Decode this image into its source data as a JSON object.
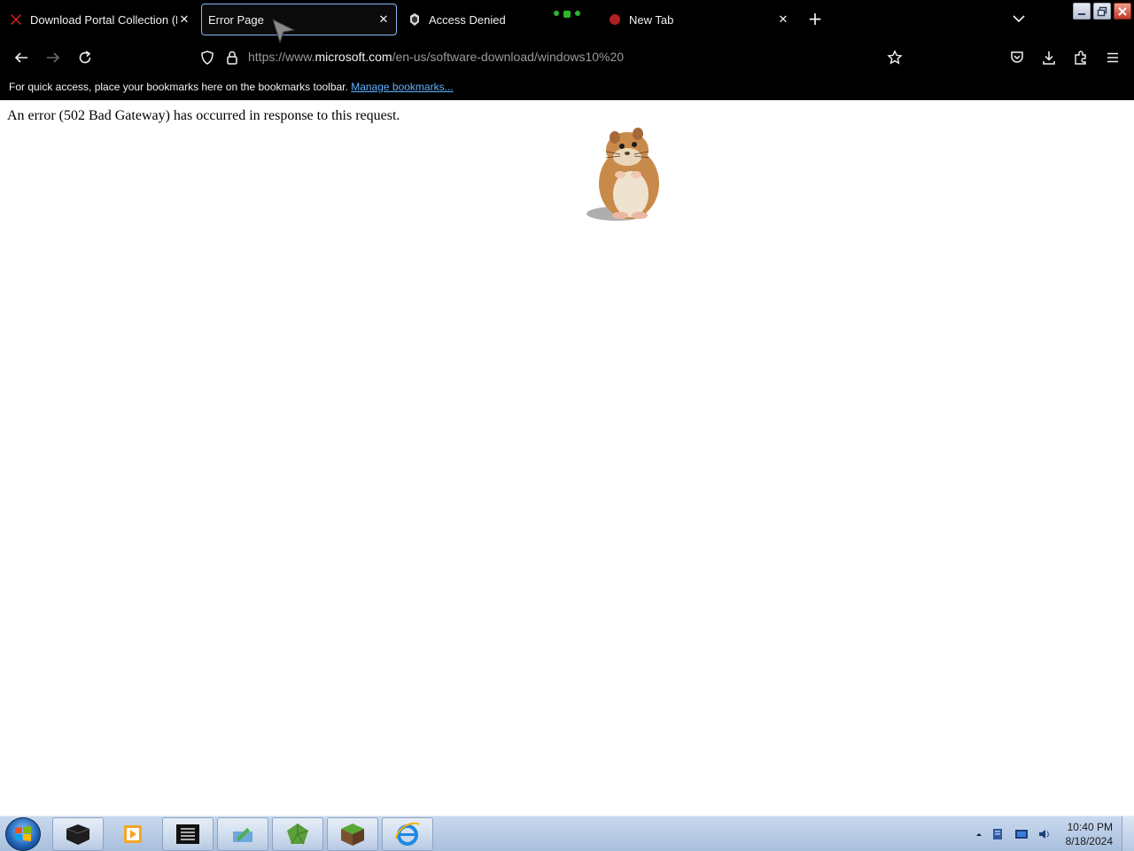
{
  "browser": {
    "tabs": [
      {
        "title": "Download Portal Collection (M",
        "favicon": "red-x-icon",
        "active": false,
        "close_label": "✕"
      },
      {
        "title": "Error Page",
        "favicon": "none",
        "active": true,
        "close_label": "✕"
      },
      {
        "title": "Access Denied",
        "favicon": "access-denied-icon",
        "active": false,
        "close_label": ""
      },
      {
        "title": "New Tab",
        "favicon": "newtab-icon",
        "active": false,
        "close_label": "✕"
      }
    ],
    "new_tab_label": "+",
    "url": {
      "scheme": "https://www.",
      "host": "microsoft.com",
      "path": "/en-us/software-download/windows10%20"
    },
    "bookmarks_bar": {
      "message": "For quick access, place your bookmarks here on the bookmarks toolbar.",
      "link": "Manage bookmarks..."
    }
  },
  "page": {
    "error_message": "An error (502 Bad Gateway) has occurred in response to this request.",
    "image": "hamster-image"
  },
  "taskbar": {
    "apps": [
      "terminal-icon",
      "media-player-icon",
      "console-icon",
      "file-manager-icon",
      "gem-icon",
      "minecraft-icon",
      "internet-explorer-icon"
    ],
    "clock": {
      "time": "10:40 PM",
      "date": "8/18/2024"
    }
  },
  "colors": {
    "link": "#5fb2ff",
    "active_tab_border": "#8ab4f8"
  }
}
